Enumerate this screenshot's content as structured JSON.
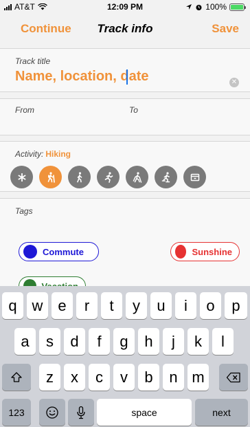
{
  "status_bar": {
    "carrier": "AT&T",
    "time": "12:09 PM",
    "battery": "100%",
    "battery_level": 1.0,
    "icons": [
      "signal-icon",
      "wifi-icon",
      "location-icon",
      "alarm-icon",
      "battery-icon"
    ]
  },
  "nav": {
    "left_label": "Continue",
    "title": "Track info",
    "right_label": "Save"
  },
  "title_field": {
    "label": "Track title",
    "placeholder": "Name, location, date",
    "value": ""
  },
  "from_to": {
    "from_label": "From",
    "to_label": "To"
  },
  "activity": {
    "label": "Activity:",
    "value": "Hiking",
    "icons": [
      "asterisk-icon",
      "hiking-icon",
      "walking-icon",
      "running-icon",
      "nordic-walking-icon",
      "skating-icon",
      "more-icon"
    ],
    "selected_index": 1
  },
  "tags": {
    "label": "Tags",
    "items": [
      {
        "label": "Commute",
        "color": "#1e18d6"
      },
      {
        "label": "Sunshine",
        "color": "#e63232"
      },
      {
        "label": "Vacation",
        "color": "#2e7d32"
      }
    ]
  },
  "keyboard": {
    "row1": [
      "q",
      "w",
      "e",
      "r",
      "t",
      "y",
      "u",
      "i",
      "o",
      "p"
    ],
    "row2": [
      "a",
      "s",
      "d",
      "f",
      "g",
      "h",
      "j",
      "k",
      "l"
    ],
    "row3": [
      "z",
      "x",
      "c",
      "v",
      "b",
      "n",
      "m"
    ],
    "numbers_key": "123",
    "space_key": "space",
    "next_key": "next"
  },
  "colors": {
    "accent": "#f0923a",
    "icon_gray": "#7a7a7a"
  }
}
